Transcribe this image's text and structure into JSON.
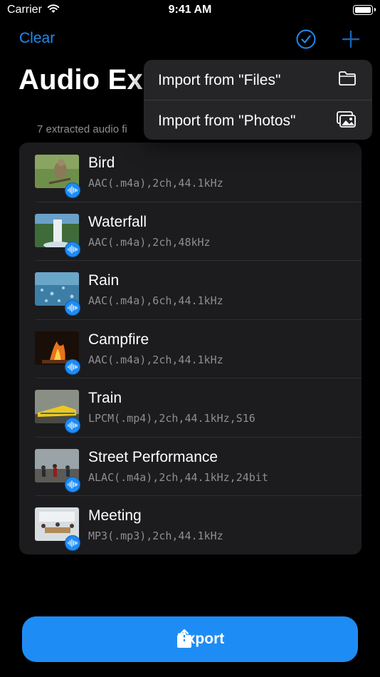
{
  "status_bar": {
    "carrier": "Carrier",
    "time": "9:41 AM"
  },
  "nav": {
    "clear_label": "Clear",
    "title": "Audio Ex"
  },
  "subtitle": "7 extracted audio fi",
  "menu": {
    "items": [
      {
        "label": "Import from \"Files\"",
        "icon": "folder-icon"
      },
      {
        "label": "Import from \"Photos\"",
        "icon": "photos-icon"
      }
    ]
  },
  "items": [
    {
      "title": "Bird",
      "meta": "AAC(.m4a),2ch,44.1kHz",
      "thumb": "bird"
    },
    {
      "title": "Waterfall",
      "meta": "AAC(.m4a),2ch,48kHz",
      "thumb": "waterfall"
    },
    {
      "title": "Rain",
      "meta": "AAC(.m4a),6ch,44.1kHz",
      "thumb": "rain"
    },
    {
      "title": "Campfire",
      "meta": "AAC(.m4a),2ch,44.1kHz",
      "thumb": "campfire"
    },
    {
      "title": "Train",
      "meta": "LPCM(.mp4),2ch,44.1kHz,S16",
      "thumb": "train"
    },
    {
      "title": "Street Performance",
      "meta": "ALAC(.m4a),2ch,44.1kHz,24bit",
      "thumb": "street"
    },
    {
      "title": "Meeting",
      "meta": "MP3(.mp3),2ch,44.1kHz",
      "thumb": "meeting"
    }
  ],
  "export_label": "Export",
  "colors": {
    "accent": "#1e8cf5",
    "background": "#000000",
    "card": "#1c1c1e",
    "secondary_text": "#8e8e93"
  }
}
